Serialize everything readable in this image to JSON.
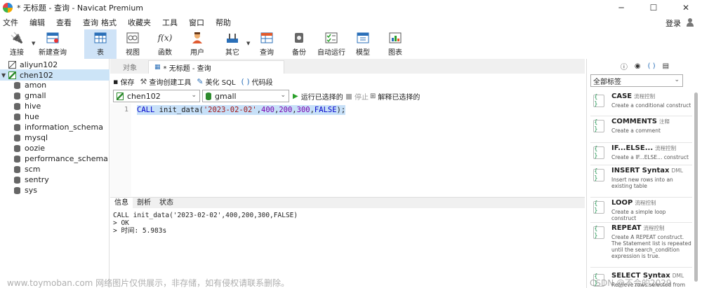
{
  "window": {
    "title": "* 无标题 - 查询 - Navicat Premium",
    "controls": [
      "─",
      "☐",
      "✕"
    ]
  },
  "menu": [
    "文件",
    "编辑",
    "查看",
    "查询",
    "格式",
    "收藏夹",
    "工具",
    "窗口",
    "帮助"
  ],
  "login_label": "登录",
  "toolbar": [
    {
      "label": "连接",
      "icon": "plug-icon"
    },
    {
      "label": "新建查询",
      "icon": "new-query-icon"
    },
    {
      "label": "表",
      "icon": "table-icon"
    },
    {
      "label": "视图",
      "icon": "view-icon"
    },
    {
      "label": "函数",
      "icon": "function-icon",
      "glyph": "f(x)"
    },
    {
      "label": "用户",
      "icon": "user-icon"
    },
    {
      "label": "其它",
      "icon": "tools-icon"
    },
    {
      "label": "查询",
      "icon": "query-icon"
    },
    {
      "label": "备份",
      "icon": "backup-icon"
    },
    {
      "label": "自动运行",
      "icon": "automation-icon"
    },
    {
      "label": "模型",
      "icon": "model-icon"
    },
    {
      "label": "图表",
      "icon": "chart-icon"
    }
  ],
  "navigator": {
    "connections": [
      {
        "name": "aliyun102",
        "expanded": false
      },
      {
        "name": "chen102",
        "expanded": true
      }
    ],
    "databases": [
      "amon",
      "gmall",
      "hive",
      "hue",
      "information_schema",
      "mysql",
      "oozie",
      "performance_schema",
      "scm",
      "sentry",
      "sys"
    ]
  },
  "tabs": {
    "objects": "对象",
    "query": "* 无标题 - 查询"
  },
  "query_toolbar": {
    "save": "保存",
    "builder": "查询创建工具",
    "beautify": "美化 SQL",
    "snippet": "代码段"
  },
  "selectors": {
    "connection": "chen102",
    "database": "gmall",
    "run_selected": "运行已选择的",
    "stop": "停止",
    "explain_selected": "解释已选择的"
  },
  "editor": {
    "line_number": "1",
    "sql": {
      "kw": "CALL",
      "fn": " init_data(",
      "s1": "'2023-02-02'",
      "c1": ",",
      "n1": "400",
      "c2": ",",
      "n2": "200",
      "c3": ",",
      "n3": "300",
      "c4": ",",
      "kw2": "FALSE",
      "end": ");"
    }
  },
  "result_tabs": [
    "信息",
    "剖析",
    "状态"
  ],
  "messages": [
    "CALL init_data('2023-02-02',400,200,300,FALSE)",
    "> OK",
    "> 时间: 5.983s"
  ],
  "right_pane": {
    "icons": [
      "ⓘ",
      "◉",
      "( )",
      "▤"
    ],
    "filter": "全部标签",
    "snippets": [
      {
        "title": "CASE",
        "tag": "流程控制",
        "desc": "Create a conditional construct"
      },
      {
        "title": "COMMENTS",
        "tag": "注释",
        "desc": "Create a comment"
      },
      {
        "title": "IF...ELSE...",
        "tag": "流程控制",
        "desc": "Create a IF...ELSE... construct"
      },
      {
        "title": "INSERT Syntax",
        "tag": "DML",
        "desc": "Insert new rows into an existing table"
      },
      {
        "title": "LOOP",
        "tag": "流程控制",
        "desc": "Create a simple loop construct"
      },
      {
        "title": "REPEAT",
        "tag": "流程控制",
        "desc": "Create A REPEAT construct. The Statement list is repeated until the search_condition expression is true."
      },
      {
        "title": "SELECT Syntax",
        "tag": "DML",
        "desc": "Retrieve rows selected from one"
      }
    ]
  },
  "watermark": "www.toymoban.com 网络图片仅供展示，非存储，如有侵权请联系删除。",
  "watermark_right": "CSDN @不会的2029"
}
